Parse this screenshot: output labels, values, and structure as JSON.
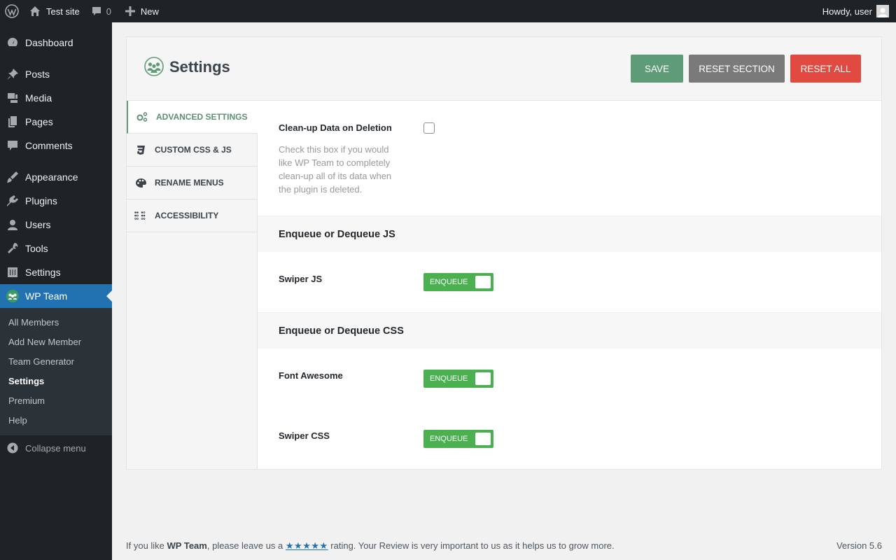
{
  "adminbar": {
    "site_name": "Test site",
    "comments_count": "0",
    "new_label": "New",
    "howdy": "Howdy, user"
  },
  "sidebar": {
    "items": [
      {
        "label": "Dashboard",
        "icon": "dashboard-icon"
      },
      {
        "label": "Posts",
        "icon": "pin-icon"
      },
      {
        "label": "Media",
        "icon": "media-icon"
      },
      {
        "label": "Pages",
        "icon": "pages-icon"
      },
      {
        "label": "Comments",
        "icon": "comment-icon"
      },
      {
        "label": "Appearance",
        "icon": "brush-icon"
      },
      {
        "label": "Plugins",
        "icon": "plug-icon"
      },
      {
        "label": "Users",
        "icon": "user-icon"
      },
      {
        "label": "Tools",
        "icon": "wrench-icon"
      },
      {
        "label": "Settings",
        "icon": "sliders-icon"
      },
      {
        "label": "WP Team",
        "icon": "team-icon"
      }
    ],
    "submenu": [
      "All Members",
      "Add New Member",
      "Team Generator",
      "Settings",
      "Premium",
      "Help"
    ],
    "collapse_label": "Collapse menu"
  },
  "panel": {
    "title": "Settings",
    "buttons": {
      "save": "SAVE",
      "reset_section": "RESET SECTION",
      "reset_all": "RESET ALL"
    },
    "tabs": [
      {
        "label": "ADVANCED SETTINGS",
        "icon": "gears-icon"
      },
      {
        "label": "CUSTOM CSS & JS",
        "icon": "css3-icon"
      },
      {
        "label": "RENAME MENUS",
        "icon": "palette-icon"
      },
      {
        "label": "ACCESSIBILITY",
        "icon": "braille-icon"
      }
    ],
    "cleanup": {
      "label": "Clean-up Data on Deletion",
      "description": "Check this box if you would like WP Team to completely clean-up all of its data when the plugin is deleted.",
      "checked": false
    },
    "js_section": {
      "title": "Enqueue or Dequeue JS",
      "swiper_js": "Swiper JS",
      "toggle": "ENQUEUE"
    },
    "css_section": {
      "title": "Enqueue or Dequeue CSS",
      "font_awesome": "Font Awesome",
      "swiper_css": "Swiper CSS",
      "toggle": "ENQUEUE"
    }
  },
  "footer": {
    "prefix": "If you like ",
    "plugin": "WP Team",
    "middle": ", please leave us a ",
    "stars": "★★★★★",
    "suffix": " rating. Your Review is very important to us as it helps us to grow more.",
    "version": "Version 5.6"
  },
  "colors": {
    "accent": "#5e9c78",
    "toggle_green": "#4bb04f",
    "reset_all": "#e04a40",
    "wp_blue": "#2271b1"
  }
}
